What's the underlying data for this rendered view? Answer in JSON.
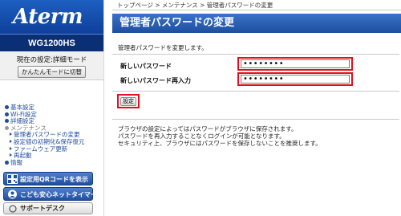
{
  "sidebar": {
    "logo": "Aterm",
    "model": "WG1200HS",
    "mode_text": "現在の設定:詳細モード",
    "simple_mode_button": "かんたんモードに切替",
    "nav": [
      {
        "label": "基本設定"
      },
      {
        "label": "Wi-Fi設定"
      },
      {
        "label": "詳細設定"
      },
      {
        "label": "メンテナンス",
        "open": true
      },
      {
        "label": "管理者パスワードの変更",
        "sub": true
      },
      {
        "label": "設定値の初期化&保存復元",
        "sub": true
      },
      {
        "label": "ファームウェア更新",
        "sub": true
      },
      {
        "label": "再起動",
        "sub": true
      },
      {
        "label": "情報"
      }
    ],
    "qr_button": "設定用QRコードを表示",
    "kids_button": "こども安心ネットタイマー",
    "support_button": "サポートデスク"
  },
  "main": {
    "breadcrumb": "トップページ > メンテナンス > 管理者パスワードの変更",
    "title": "管理者パスワードの変更",
    "description": "管理者パスワードを変更します。",
    "new_password_label": "新しいパスワード",
    "new_password_value": "••••••••",
    "confirm_password_label": "新しいパスワード再入力",
    "confirm_password_value": "••••••••",
    "set_button": "設定",
    "notes": [
      "ブラウザの設定によってはパスワードがブラウザに保存されます。",
      "パスワードを再入力することなくログインが可能となります。",
      "セキュリティ上、ブラウザにはパスワードを保存しないことを推奨します。"
    ]
  },
  "colors": {
    "accent_blue": "#1e4f9e",
    "highlight_red": "#e01020"
  }
}
